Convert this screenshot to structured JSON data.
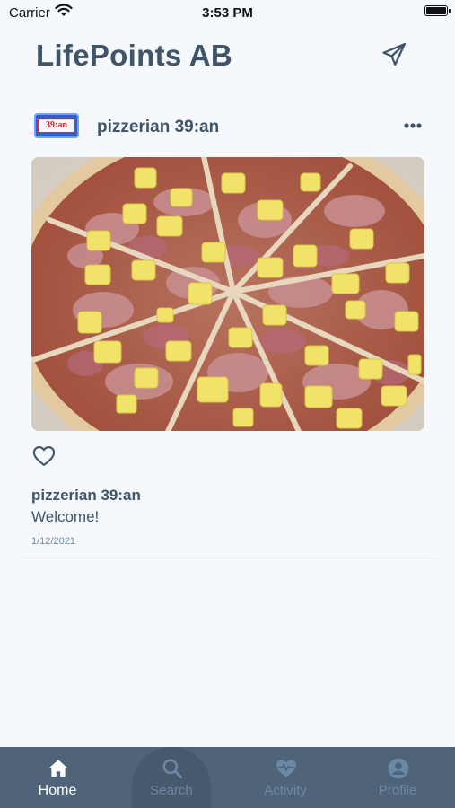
{
  "status_bar": {
    "carrier": "Carrier",
    "time": "3:53 PM"
  },
  "header": {
    "title": "LifePoints AB",
    "send_icon": "paper-plane-icon"
  },
  "post": {
    "avatar_text": "39:an",
    "username": "pizzerian 39:an",
    "menu_icon": "more-horizontal-icon",
    "image_description_icon": "pizza-photo",
    "caption_username": "pizzerian 39:an",
    "caption_text": "Welcome!",
    "date": "1/12/2021",
    "like_icon": "heart-outline-icon"
  },
  "tab_bar": {
    "colors": {
      "active": "#ffffff",
      "inactive": "#6b89a6",
      "background": "#4f6479"
    },
    "tabs": [
      {
        "label": "Home",
        "icon": "home-icon",
        "active": true
      },
      {
        "label": "Search",
        "icon": "search-icon",
        "active": false
      },
      {
        "label": "Activity",
        "icon": "heart-pulse-icon",
        "active": false
      },
      {
        "label": "Profile",
        "icon": "profile-icon",
        "active": false
      }
    ]
  }
}
